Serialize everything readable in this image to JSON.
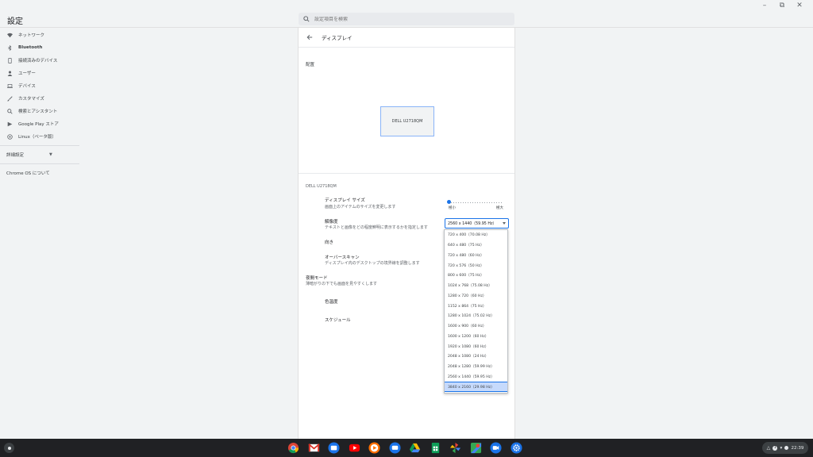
{
  "window": {
    "title": "設定",
    "controls": [
      "–",
      "⧉",
      "✕"
    ]
  },
  "search": {
    "placeholder": "設定項目を検索"
  },
  "sidebar": {
    "items": [
      {
        "label": "ネットワーク",
        "icon": "wifi-icon"
      },
      {
        "label": "Bluetooth",
        "icon": "bluetooth-icon"
      },
      {
        "label": "接続済みのデバイス",
        "icon": "phone-icon"
      },
      {
        "label": "ユーザー",
        "icon": "person-icon"
      },
      {
        "label": "デバイス",
        "icon": "laptop-icon"
      },
      {
        "label": "カスタマイズ",
        "icon": "brush-icon"
      },
      {
        "label": "検索とアシスタント",
        "icon": "search-icon"
      },
      {
        "label": "Google Play ストア",
        "icon": "play-store-icon"
      },
      {
        "label": "Linux（ベータ版）",
        "icon": "linux-icon"
      }
    ],
    "advanced": "詳細設定",
    "about": "Chrome OS について"
  },
  "main": {
    "page_title": "ディスプレイ",
    "arrangement_label": "配置",
    "monitor_name": "DELL U2718QM",
    "device_heading": "DELL U2718QM",
    "display_size": {
      "title": "ディスプレイ サイズ",
      "subtitle": "画面上のアイテムのサイズを変更します",
      "min_label": "極小",
      "max_label": "極大",
      "value": 0.0
    },
    "resolution": {
      "title": "解像度",
      "subtitle": "テキストと画像をどの程度鮮明に表示するかを指定します",
      "selected": "2560 x 1440（59.95 Hz）"
    },
    "orientation": {
      "title": "向き"
    },
    "overscan": {
      "title": "オーバースキャン",
      "subtitle": "ディスプレイ内のデスクトップの境界線を調整します"
    },
    "night_light": {
      "title": "夜間モード",
      "subtitle": "薄暗がりの下でも画面を見やすくします"
    },
    "color_temp": {
      "title": "色温度"
    },
    "schedule": {
      "title": "スケジュール"
    }
  },
  "dropdown": {
    "options": [
      "720 x 400（70.08 Hz）",
      "640 x 480（75 Hz）",
      "720 x 480（60 Hz）",
      "720 x 576（50 Hz）",
      "800 x 600（75 Hz）",
      "1024 x 768（75.08 Hz）",
      "1280 x 720（60 Hz）",
      "1152 x 864（75 Hz）",
      "1280 x 1024（75.02 Hz）",
      "1600 x 900（60 Hz）",
      "1600 x 1200（60 Hz）",
      "1920 x 1080（60 Hz）",
      "2048 x 1080（24 Hz）",
      "2048 x 1280（59.99 Hz）",
      "2560 x 1440（59.95 Hz）",
      "3840 x 2160（29.98 Hz）"
    ],
    "highlighted_index": 15
  },
  "shelf": {
    "apps": [
      "chrome-icon",
      "gmail-icon",
      "files-icon",
      "youtube-icon",
      "play-music-icon",
      "messages-icon",
      "drive-icon",
      "sheets-icon",
      "pinwheel-icon",
      "maps-icon",
      "duo-icon",
      "settings-icon"
    ],
    "time": "22:39",
    "notification_count": "1"
  }
}
